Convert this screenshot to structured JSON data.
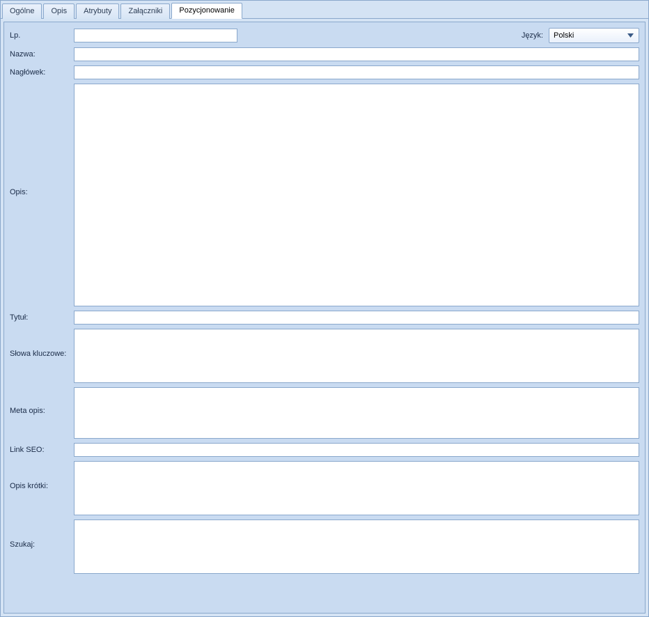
{
  "tabs": [
    {
      "label": "Ogólne"
    },
    {
      "label": "Opis"
    },
    {
      "label": "Atrybuty"
    },
    {
      "label": "Załączniki"
    },
    {
      "label": "Pozycjonowanie"
    }
  ],
  "activeTab": 4,
  "labels": {
    "lp": "Lp.",
    "language": "Język:",
    "name": "Nazwa:",
    "header": "Nagłówek:",
    "description": "Opis:",
    "title": "Tytuł:",
    "keywords": "Słowa kluczowe:",
    "metaDesc": "Meta opis:",
    "seoLink": "Link SEO:",
    "shortDesc": "Opis krótki:",
    "search": "Szukaj:"
  },
  "languageSelect": {
    "selected": "Polski"
  },
  "values": {
    "lp": "",
    "name": "",
    "header": "",
    "description": "",
    "title": "",
    "keywords": "",
    "metaDesc": "",
    "seoLink": "",
    "shortDesc": "",
    "search": ""
  }
}
